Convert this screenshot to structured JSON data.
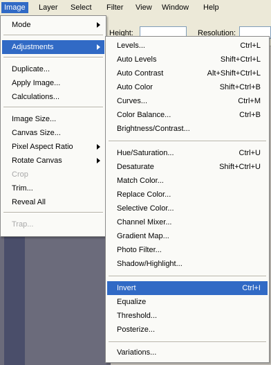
{
  "menubar": {
    "items": [
      "Image",
      "Layer",
      "Select",
      "Filter",
      "View",
      "Window",
      "Help"
    ]
  },
  "options_bar": {
    "height_label": "Height:",
    "resolution_label": "Resolution:"
  },
  "image_menu": {
    "items": [
      {
        "label": "Mode",
        "submenu": true
      },
      {
        "label": "Adjustments",
        "submenu": true,
        "highlighted": true
      },
      {
        "label": "Duplicate..."
      },
      {
        "label": "Apply Image..."
      },
      {
        "label": "Calculations..."
      },
      {
        "label": "Image Size..."
      },
      {
        "label": "Canvas Size..."
      },
      {
        "label": "Pixel Aspect Ratio",
        "submenu": true
      },
      {
        "label": "Rotate Canvas",
        "submenu": true
      },
      {
        "label": "Crop",
        "disabled": true
      },
      {
        "label": "Trim..."
      },
      {
        "label": "Reveal All"
      },
      {
        "label": "Trap...",
        "disabled": true
      }
    ]
  },
  "adjustments_menu": {
    "items": [
      {
        "label": "Levels...",
        "shortcut": "Ctrl+L"
      },
      {
        "label": "Auto Levels",
        "shortcut": "Shift+Ctrl+L"
      },
      {
        "label": "Auto Contrast",
        "shortcut": "Alt+Shift+Ctrl+L"
      },
      {
        "label": "Auto Color",
        "shortcut": "Shift+Ctrl+B"
      },
      {
        "label": "Curves...",
        "shortcut": "Ctrl+M"
      },
      {
        "label": "Color Balance...",
        "shortcut": "Ctrl+B"
      },
      {
        "label": "Brightness/Contrast...",
        "shortcut": ""
      },
      {
        "label": "Hue/Saturation...",
        "shortcut": "Ctrl+U"
      },
      {
        "label": "Desaturate",
        "shortcut": "Shift+Ctrl+U"
      },
      {
        "label": "Match Color...",
        "shortcut": ""
      },
      {
        "label": "Replace Color...",
        "shortcut": ""
      },
      {
        "label": "Selective Color...",
        "shortcut": ""
      },
      {
        "label": "Channel Mixer...",
        "shortcut": ""
      },
      {
        "label": "Gradient Map...",
        "shortcut": ""
      },
      {
        "label": "Photo Filter...",
        "shortcut": ""
      },
      {
        "label": "Shadow/Highlight...",
        "shortcut": ""
      },
      {
        "label": "Invert",
        "shortcut": "Ctrl+I",
        "highlighted": true
      },
      {
        "label": "Equalize",
        "shortcut": ""
      },
      {
        "label": "Threshold...",
        "shortcut": ""
      },
      {
        "label": "Posterize...",
        "shortcut": ""
      },
      {
        "label": "Variations...",
        "shortcut": ""
      }
    ]
  },
  "colors": {
    "highlight": "#316ac5",
    "menu_bg": "#fafaf7",
    "menubar_bg": "#ece9d8"
  }
}
